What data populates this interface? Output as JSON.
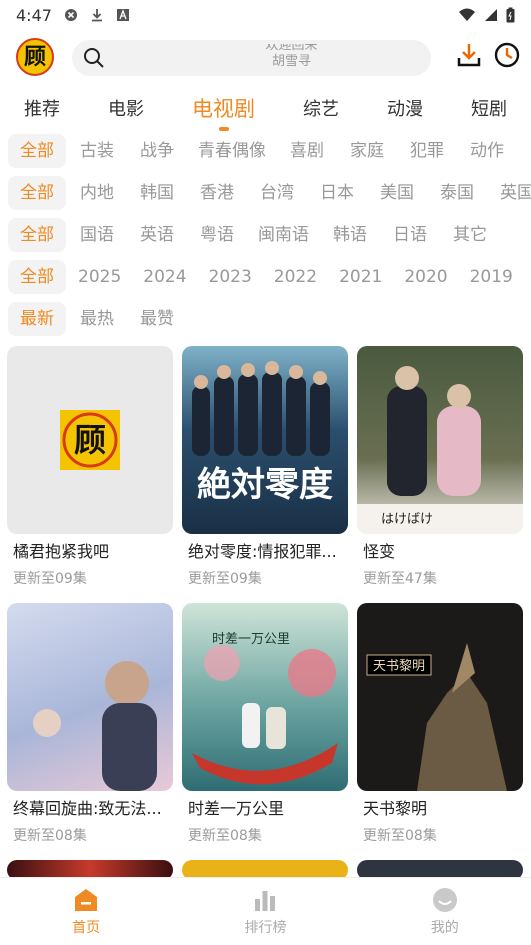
{
  "status": {
    "time": "4:47"
  },
  "search": {
    "hint_line1": "欢迎回来",
    "hint_line2": "胡雪寻"
  },
  "tabs": [
    "推荐",
    "电影",
    "电视剧",
    "综艺",
    "动漫",
    "短剧"
  ],
  "active_tab_index": 2,
  "filters": {
    "genre": [
      "全部",
      "古装",
      "战争",
      "青春偶像",
      "喜剧",
      "家庭",
      "犯罪",
      "动作"
    ],
    "region": [
      "全部",
      "内地",
      "韩国",
      "香港",
      "台湾",
      "日本",
      "美国",
      "泰国",
      "英国"
    ],
    "language": [
      "全部",
      "国语",
      "英语",
      "粤语",
      "闽南语",
      "韩语",
      "日语",
      "其它"
    ],
    "year": [
      "全部",
      "2025",
      "2024",
      "2023",
      "2022",
      "2021",
      "2020",
      "2019"
    ],
    "sort": [
      "最新",
      "最热",
      "最赞"
    ]
  },
  "cards": [
    {
      "title": "橘君抱紧我吧",
      "sub": "更新至09集",
      "poster_text": "顾",
      "bg": "#e9e9e9"
    },
    {
      "title": "绝对零度:情报犯罪...",
      "sub": "更新至09集",
      "poster_text": "絶対零度",
      "bg": "#2a4f6e"
    },
    {
      "title": "怪变",
      "sub": "更新至47集",
      "poster_text": "はけばけ",
      "bg": "#6a6f52"
    },
    {
      "title": "终幕回旋曲:致无法...",
      "sub": "更新至08集",
      "poster_text": "",
      "bg": "#a9b6d8"
    },
    {
      "title": "时差一万公里",
      "sub": "更新至08集",
      "poster_text": "时差一万公里",
      "bg": "#6aa3a0"
    },
    {
      "title": "天书黎明",
      "sub": "更新至08集",
      "poster_text": "天书黎明",
      "bg": "#1c1a18"
    }
  ],
  "nav": {
    "home": "首页",
    "rank": "排行榜",
    "mine": "我的"
  }
}
